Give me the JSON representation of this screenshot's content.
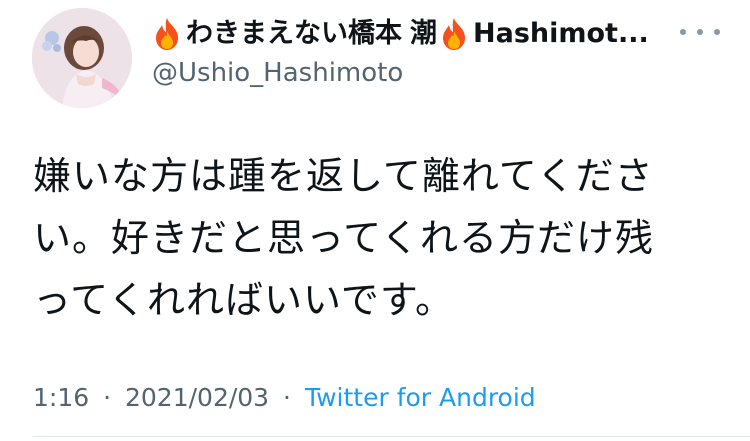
{
  "tweet": {
    "author": {
      "name_part1": "わきまえない橋本",
      "name_part2": "潮",
      "name_part3": "Hashimot...",
      "handle": "@Ushio_Hashimoto",
      "avatar_icon": "avatar-photo"
    },
    "more_icon": "more-options-icon",
    "text_lines": [
      "嫌いな方は踵を返して離れてくださ",
      "い。好きだと思ってくれる方だけ残",
      "ってくれればいいです。"
    ],
    "time": "1:16",
    "date": "2021/02/03",
    "separator": "·",
    "source": "Twitter for Android"
  },
  "colors": {
    "text": "#0f1419",
    "secondary": "#536471",
    "link": "#1d9bf0",
    "fire_outer": "#f4511e",
    "fire_inner": "#ffb300"
  }
}
